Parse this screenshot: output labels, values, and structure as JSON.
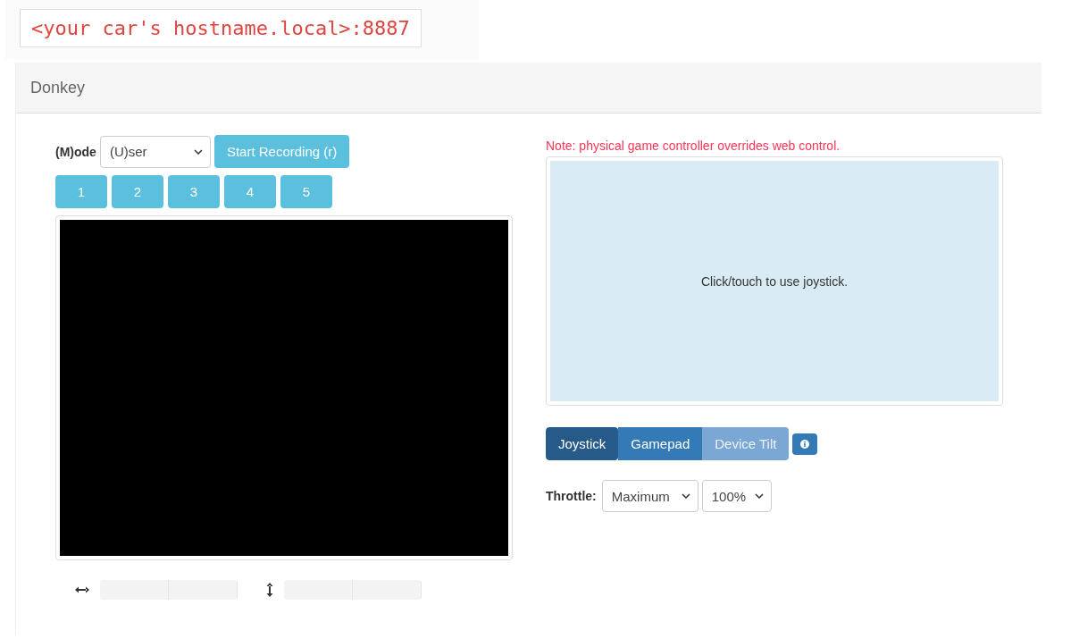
{
  "address": "<your car's hostname.local>:8887",
  "panel": {
    "title": "Donkey"
  },
  "mode": {
    "label": "(M)ode",
    "value": "(U)ser"
  },
  "record_button": "Start Recording (r)",
  "number_buttons": [
    "1",
    "2",
    "3",
    "4",
    "5"
  ],
  "note": "Note: physical game controller overrides web control.",
  "joystick_area": {
    "text": "Click/touch to use joystick."
  },
  "control_tabs": [
    {
      "label": "Joystick",
      "selected": true,
      "disabled": false
    },
    {
      "label": "Gamepad",
      "selected": false,
      "disabled": false
    },
    {
      "label": "Device Tilt",
      "selected": false,
      "disabled": true
    }
  ],
  "throttle": {
    "label": "Throttle:",
    "mode": "Maximum",
    "value": "100%"
  },
  "gauges": [
    {
      "kind": "horizontal"
    },
    {
      "kind": "vertical"
    }
  ]
}
